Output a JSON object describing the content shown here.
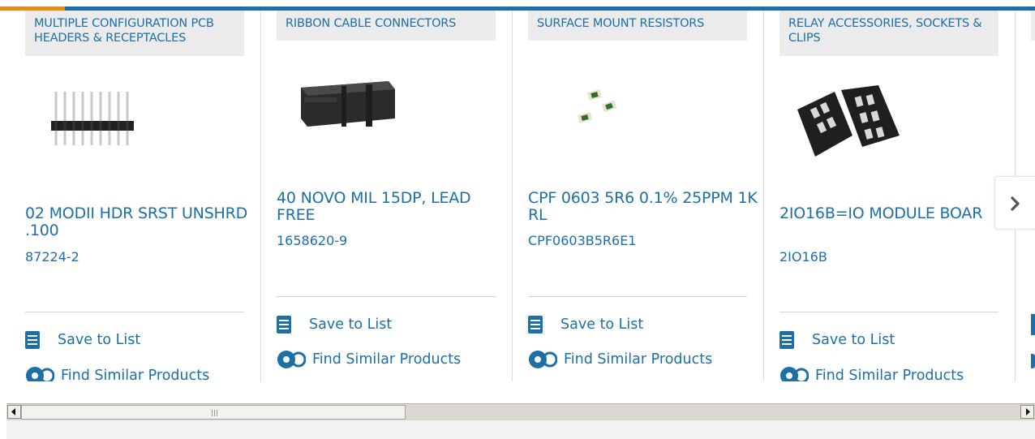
{
  "colors": {
    "link": "#1d6fa8",
    "topbar": "#1a6fa8",
    "accent": "#e88a1a",
    "category_bg": "#ebebeb"
  },
  "products": [
    {
      "category": "MULTIPLE CONFIGURATION PCB HEADERS & RECEPTACLES",
      "title": "02 MODII HDR SRST UNSHRD .100",
      "part_number": "87224-2",
      "image": "pin-header-image"
    },
    {
      "category": "RIBBON CABLE CONNECTORS",
      "title": "40 NOVO MIL 15DP, LEAD FREE",
      "part_number": "1658620-9",
      "image": "ribbon-connector-image"
    },
    {
      "category": "SURFACE MOUNT RESISTORS",
      "title": "CPF 0603 5R6 0.1% 25PPM 1K RL",
      "part_number": "CPF0603B5R6E1",
      "image": "smd-resistor-image"
    },
    {
      "category": "RELAY ACCESSORIES, SOCKETS & CLIPS",
      "title": "2IO16B=IO MODULE BOAR",
      "part_number": "2IO16B",
      "image": "io-module-image"
    }
  ],
  "actions": {
    "save_label": "Save to List",
    "similar_label": "Find Similar Products"
  },
  "carousel": {
    "next_icon": "chevron-right-icon"
  },
  "scrollbar": {
    "left_icon": "arrow-left-icon",
    "right_icon": "arrow-right-icon"
  }
}
